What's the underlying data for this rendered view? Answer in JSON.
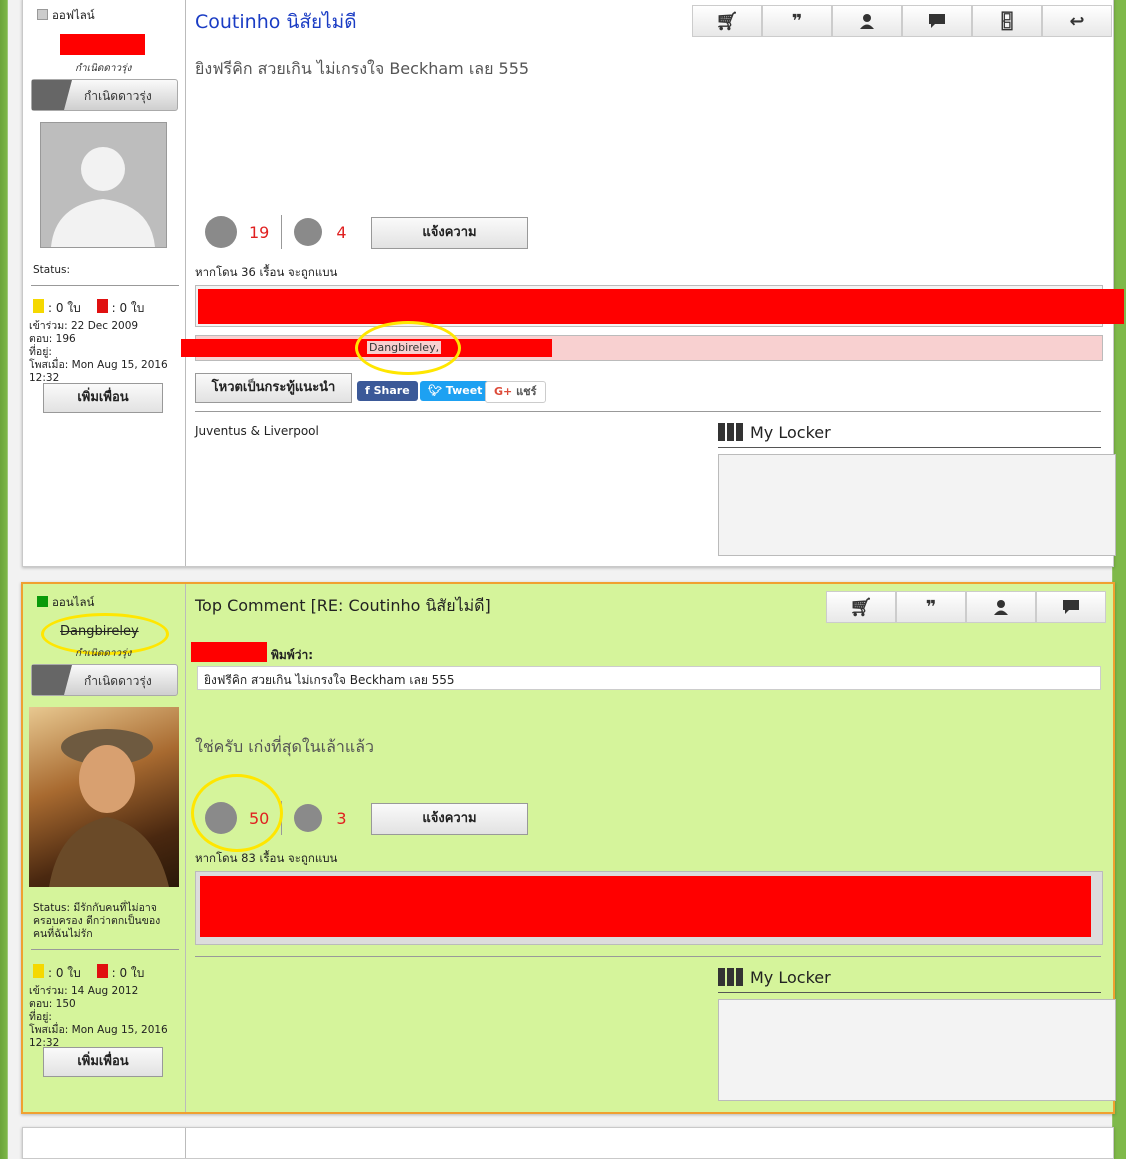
{
  "post1": {
    "online_status": "ออฟไลน์",
    "rank_small": "กำเนิดดาวรุ่ง",
    "rank_button": "กำเนิดดาวรุ่ง",
    "status_label": "Status:",
    "yellow_cards": ": 0 ใบ",
    "red_cards": ": 0 ใบ",
    "joined": "เข้าร่วม: 22 Dec 2009",
    "replies": "ตอบ: 196",
    "location": "ที่อยู่:",
    "posted": "โพสเมื่อ: Mon Aug 15, 2016 12:32",
    "add_friend": "เพิ่มเพื่อน",
    "title": "Coutinho นิสัยไม่ดี",
    "body": "ยิงฟรีคิก สวยเกิน ไม่เกรงใจ Beckham เลย 555",
    "likes": "19",
    "dislikes": "4",
    "report_button": "แจ้งความ",
    "ban_note": "หากโดน 36 เรื้อน จะถูกแบน",
    "highlight_name": "Dangbireley,",
    "vote_button": "โหวตเป็นกระทู้แนะนำ",
    "share_fb": "Share",
    "share_tw": "Tweet",
    "share_gplus": "แชร์",
    "signature": "Juventus & Liverpool",
    "locker_title": "My Locker"
  },
  "post2": {
    "online_status": "ออนไลน์",
    "username": "Dangbireley",
    "rank_small": "กำเนิดดาวรุ่ง",
    "rank_button": "กำเนิดดาวรุ่ง",
    "status_text": "Status: มีรักกับคนที่ไม่อาจครอบครอง ดีกว่าตกเป็นของคนที่ฉันไม่รัก",
    "yellow_cards": ": 0 ใบ",
    "red_cards": ": 0 ใบ",
    "joined": "เข้าร่วม: 14 Aug 2012",
    "replies": "ตอบ: 150",
    "location": "ที่อยู่:",
    "posted": "โพสเมื่อ: Mon Aug 15, 2016 12:32",
    "add_friend": "เพิ่มเพื่อน",
    "title": "Top Comment [RE: Coutinho นิสัยไม่ดี]",
    "quote_label": "พิมพ์ว่า:",
    "quote_text": "ยิงฟรีคิก สวยเกิน ไม่เกรงใจ Beckham เลย 555",
    "body": "ใช่ครับ เก่งที่สุดในเล้าแล้ว",
    "likes": "50",
    "dislikes": "3",
    "report_button": "แจ้งความ",
    "ban_note": "หากโดน 83 เรื้อน จะถูกแบน",
    "locker_title": "My Locker"
  },
  "icons": [
    "cart-icon",
    "quote-icon",
    "user-icon",
    "comment-icon",
    "door-icon",
    "reply-icon",
    "like-face-icon",
    "dislike-face-icon",
    "locker-icon"
  ],
  "colors": {
    "accent_blue": "#1a3cc4",
    "top_bg": "#d5f49b",
    "top_border": "#f0a030",
    "redaction": "#ff0000",
    "highlight": "#ffe600"
  }
}
